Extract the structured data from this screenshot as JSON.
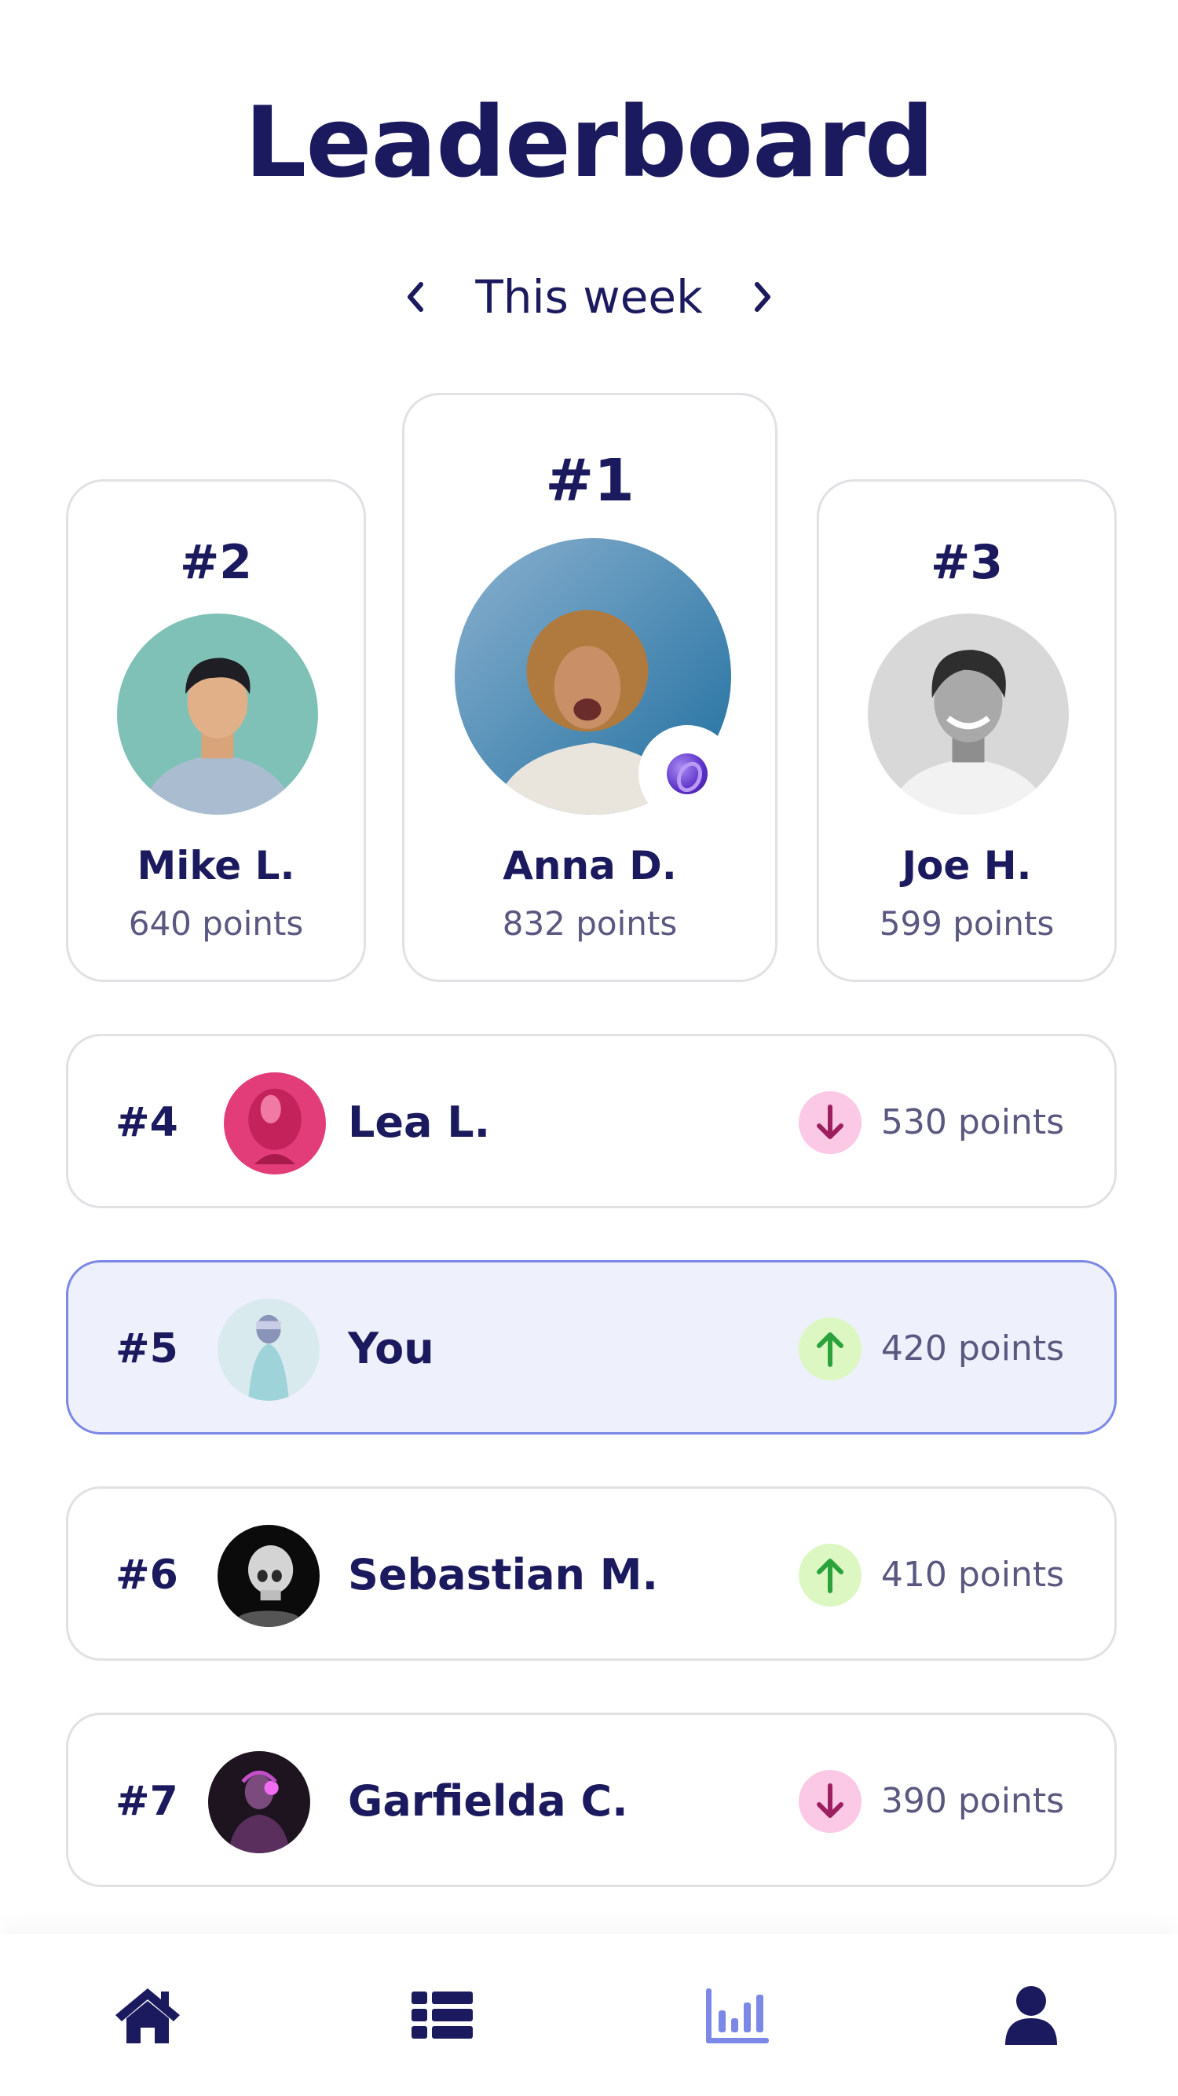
{
  "header": {
    "title": "Leaderboard"
  },
  "period": {
    "label": "This week",
    "prev_icon": "chevron-left-icon",
    "next_icon": "chevron-right-icon"
  },
  "podium": [
    {
      "rank": "#2",
      "name": "Mike L.",
      "points": "640 points"
    },
    {
      "rank": "#1",
      "name": "Anna D.",
      "points": "832 points",
      "badge_icon": "coin-icon"
    },
    {
      "rank": "#3",
      "name": "Joe H.",
      "points": "599 points"
    }
  ],
  "list": [
    {
      "rank": "#4",
      "name": "Lea L.",
      "trend": "down",
      "points": "530 points"
    },
    {
      "rank": "#5",
      "name": "You",
      "trend": "up",
      "points": "420 points",
      "highlighted": true
    },
    {
      "rank": "#6",
      "name": "Sebastian M.",
      "trend": "up",
      "points": "410 points"
    },
    {
      "rank": "#7",
      "name": "Garfielda C.",
      "trend": "down",
      "points": "390 points"
    }
  ],
  "tabbar": {
    "items": [
      {
        "icon": "home-icon",
        "active": false
      },
      {
        "icon": "list-icon",
        "active": false
      },
      {
        "icon": "chart-icon",
        "active": true
      },
      {
        "icon": "user-icon",
        "active": false
      }
    ]
  },
  "colors": {
    "primary": "#1c1a5e",
    "muted": "#5a5880",
    "accent": "#7b88e6",
    "highlight_bg": "#eef0fb",
    "trend_up_bg": "#dcf7c2",
    "trend_up": "#2aa33a",
    "trend_down_bg": "#fbc8e6",
    "trend_down": "#9c2060"
  }
}
